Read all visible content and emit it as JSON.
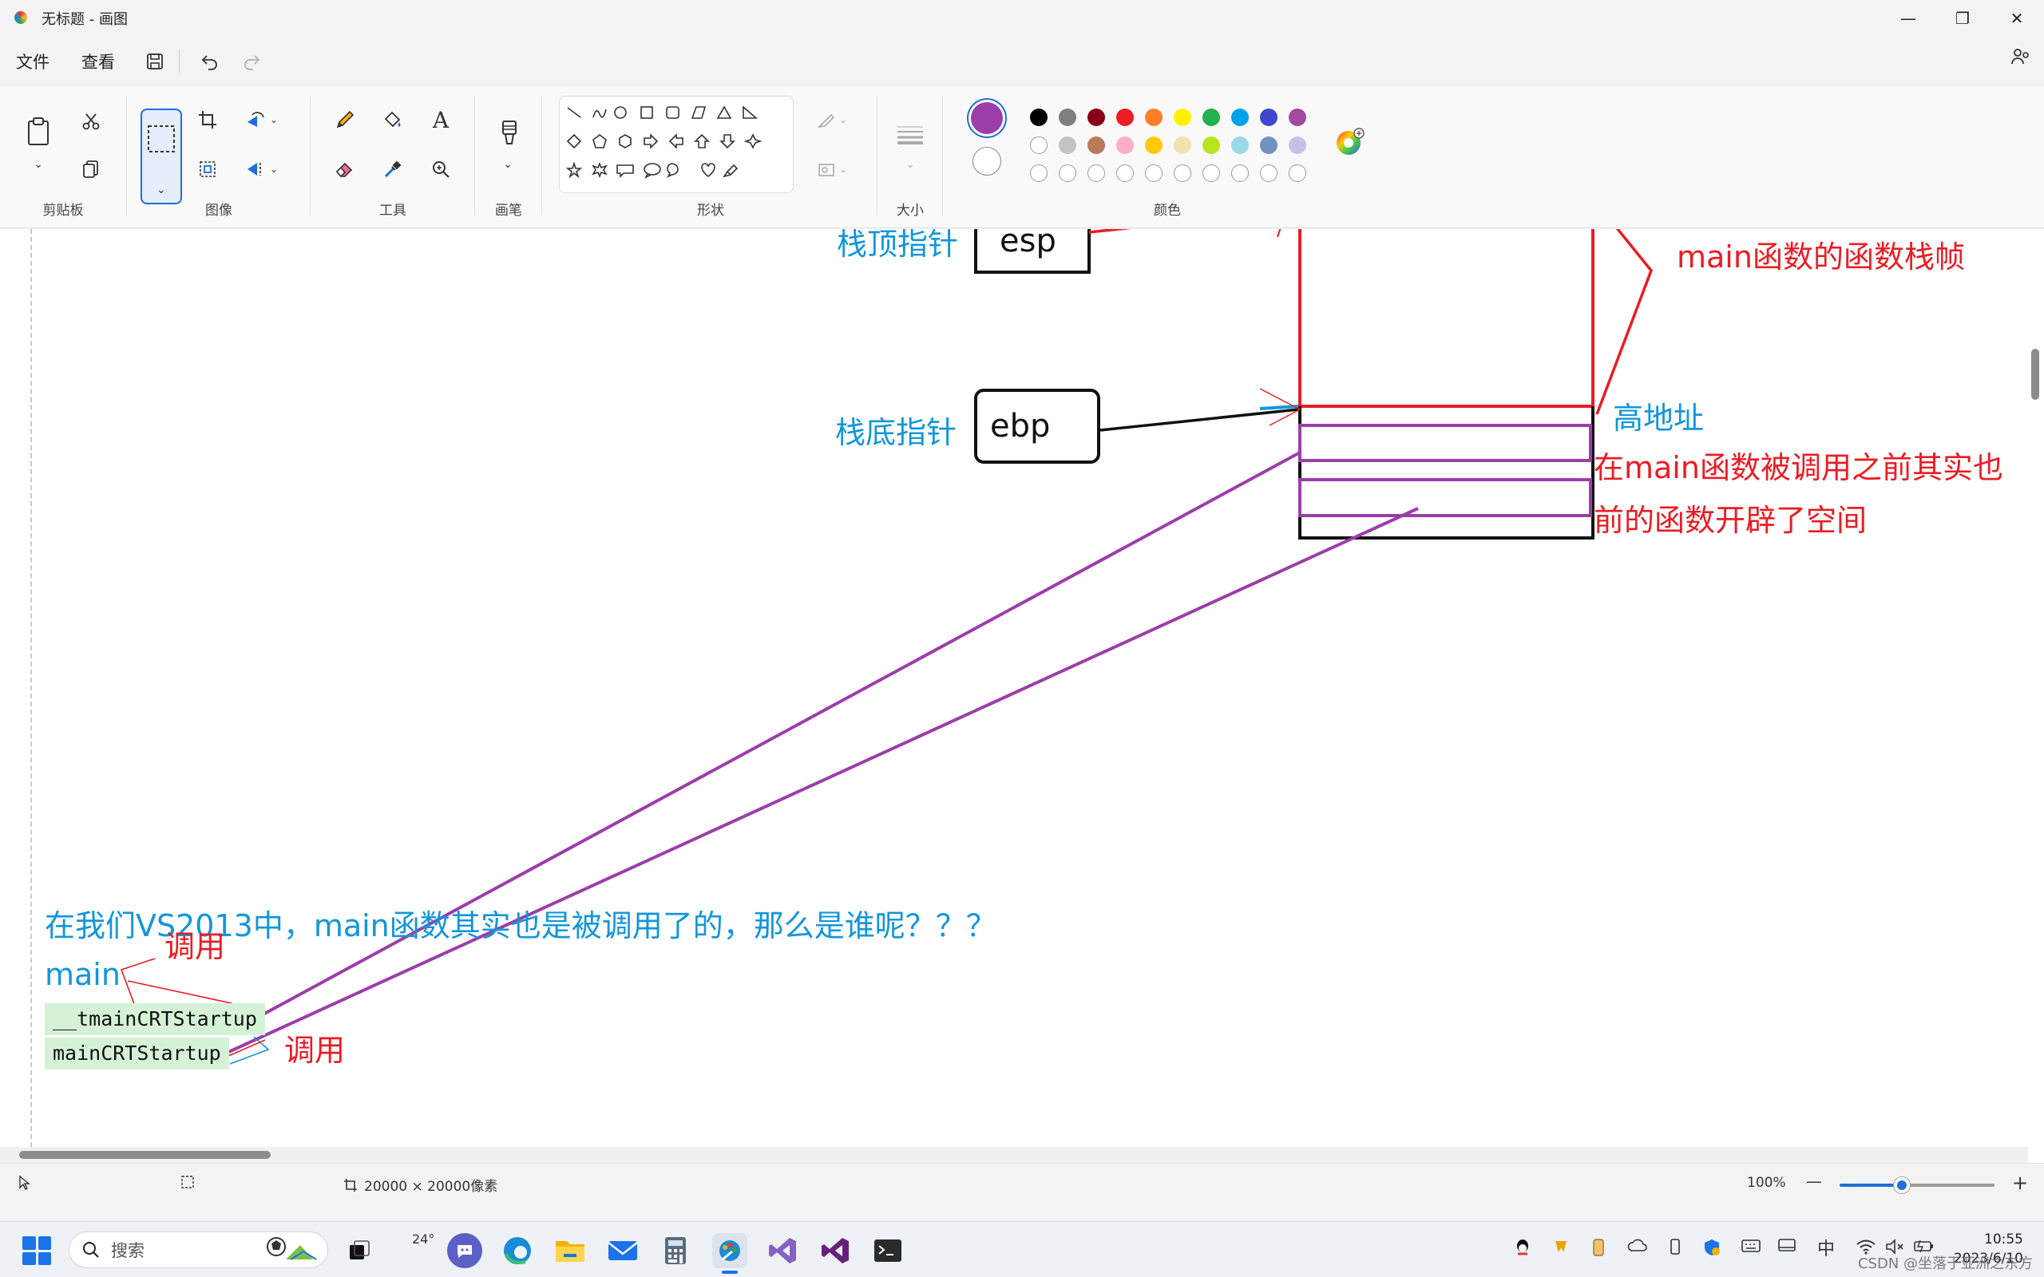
{
  "window": {
    "title": "无标题 - 画图",
    "minimize": "—",
    "maximize": "❐",
    "close": "✕"
  },
  "menu": {
    "file": "文件",
    "view": "查看",
    "save_icon": "save-icon",
    "undo_icon": "undo-icon",
    "redo_icon": "redo-icon"
  },
  "ribbon": {
    "clipboard_label": "剪贴板",
    "image_label": "图像",
    "tools_label": "工具",
    "brushes_label": "画笔",
    "shapes_label": "形状",
    "size_label": "大小",
    "colors_label": "颜色",
    "current_color1": "#9b3ea9",
    "current_color2": "#ffffff",
    "palette_row1": [
      "#000000",
      "#7f7f7f",
      "#880015",
      "#ed1c24",
      "#ff7f27",
      "#fff200",
      "#22b14c",
      "#00a2e8",
      "#3f48cc",
      "#a349a4"
    ],
    "palette_row2": [
      "#ffffff",
      "#c3c3c3",
      "#b97a57",
      "#ffaec9",
      "#ffc90e",
      "#efe4b0",
      "#b5e61d",
      "#99d9ea",
      "#7092be",
      "#c8bfe7"
    ]
  },
  "canvas": {
    "esp_label": "栈顶指针",
    "esp_reg": "esp",
    "ebp_label": "栈底指针",
    "ebp_reg": "ebp",
    "frame_label": "main函数的函数栈帧",
    "high_addr": "高地址",
    "note_line1": "在main函数被调用之前其实也",
    "note_line2": "前的函数开辟了空间",
    "question": "在我们VS2013中，main函数其实也是被调用了的，那么是谁呢？？？",
    "call1": "调用",
    "call2": "调用",
    "main": "main",
    "tmain": "__tmainCRTStartup",
    "maincrt": "mainCRTStartup"
  },
  "status": {
    "canvas_size": "20000 × 20000像素",
    "zoom": "100%",
    "zoom_out": "—",
    "zoom_in": "+"
  },
  "taskbar": {
    "search_placeholder": "搜索",
    "weather": "24°",
    "ime": "中",
    "time": "10:55",
    "date": "2023/6/10",
    "watermark": "CSDN @坐落于亚洲之东方"
  }
}
